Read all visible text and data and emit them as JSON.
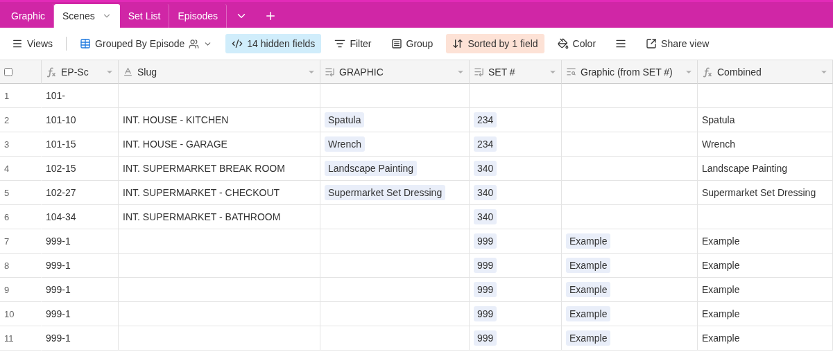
{
  "tabs": [
    {
      "label": "Graphic",
      "selected": false
    },
    {
      "label": "Scenes",
      "selected": true
    },
    {
      "label": "Set List",
      "selected": false
    },
    {
      "label": "Episodes",
      "selected": false
    }
  ],
  "toolbar": [
    {
      "kind": "views",
      "label": "Views"
    },
    {
      "kind": "view",
      "label": "Grouped By Episode"
    },
    {
      "kind": "hidden",
      "label": "14 hidden fields",
      "color": "#d0edfb"
    },
    {
      "kind": "filter",
      "label": "Filter"
    },
    {
      "kind": "group",
      "label": "Group"
    },
    {
      "kind": "sort",
      "label": "Sorted by 1 field",
      "color": "#fde2d6"
    },
    {
      "kind": "color",
      "label": "Color"
    },
    {
      "kind": "height"
    },
    {
      "kind": "share",
      "label": "Share view"
    }
  ],
  "table": {
    "select_all": {
      "checked": false
    },
    "columns": [
      {
        "kind": "formula",
        "label": "EP-Sc"
      },
      {
        "kind": "text",
        "label": "Slug"
      },
      {
        "kind": "link",
        "label": "GRAPHIC"
      },
      {
        "kind": "link",
        "label": "SET #"
      },
      {
        "kind": "lookup",
        "label": "Graphic (from SET #)"
      },
      {
        "kind": "formula",
        "label": "Combined"
      }
    ],
    "rows": [
      {
        "number": "1",
        "cells": [
          "101-",
          "",
          "",
          "",
          "",
          ""
        ]
      },
      {
        "number": "2",
        "cells": [
          "101-10",
          "INT. HOUSE - KITCHEN",
          "Spatula",
          "234",
          "",
          "Spatula"
        ]
      },
      {
        "number": "3",
        "cells": [
          "101-15",
          "INT. HOUSE - GARAGE",
          "Wrench",
          "234",
          "",
          "Wrench"
        ]
      },
      {
        "number": "4",
        "cells": [
          "102-15",
          "INT. SUPERMARKET BREAK ROOM",
          "Landscape Painting",
          "340",
          "",
          "Landscape Painting"
        ]
      },
      {
        "number": "5",
        "cells": [
          "102-27",
          "INT. SUPERMARKET - CHECKOUT",
          "Supermarket Set Dressing",
          "340",
          "",
          "Supermarket Set Dressing"
        ]
      },
      {
        "number": "6",
        "cells": [
          "104-34",
          "INT. SUPERMARKET - BATHROOM",
          "",
          "340",
          "",
          ""
        ]
      },
      {
        "number": "7",
        "cells": [
          "999-1",
          "",
          "",
          "999",
          "Example",
          "Example"
        ]
      },
      {
        "number": "8",
        "cells": [
          "999-1",
          "",
          "",
          "999",
          "Example",
          "Example"
        ]
      },
      {
        "number": "9",
        "cells": [
          "999-1",
          "",
          "",
          "999",
          "Example",
          "Example"
        ]
      },
      {
        "number": "10",
        "cells": [
          "999-1",
          "",
          "",
          "999",
          "Example",
          "Example"
        ]
      },
      {
        "number": "11",
        "cells": [
          "999-1",
          "",
          "",
          "999",
          "Example",
          "Example"
        ]
      }
    ]
  }
}
